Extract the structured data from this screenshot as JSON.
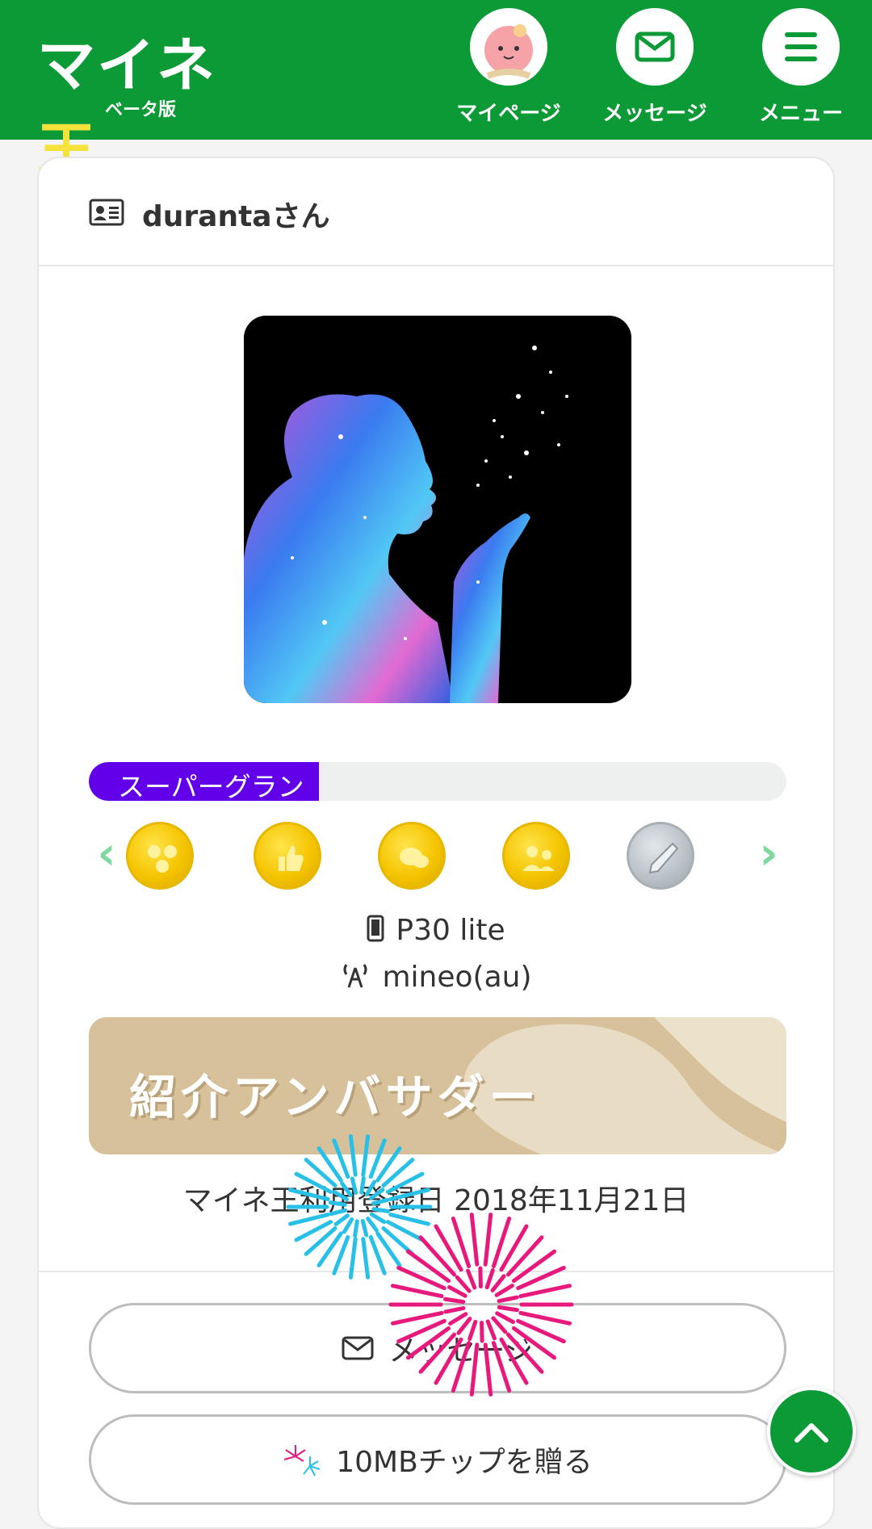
{
  "header": {
    "logo_text": "マイネ",
    "logo_king": "王",
    "logo_sub": "ベータ版",
    "nav": {
      "mypage": "マイページ",
      "message": "メッセージ",
      "menu": "メニュー"
    }
  },
  "profile": {
    "name": "durantaさん",
    "rank_label": "スーパーグラン",
    "rank_progress_fraction": 0.33,
    "badges": [
      "community-badge-icon",
      "like-badge-icon",
      "comment-badge-icon",
      "answer-badge-icon",
      "pen-badge-icon"
    ],
    "device_model": "P30 lite",
    "carrier": "mineo(au)",
    "ambassador_text": "紹介アンバサダー",
    "registration": "マイネ王利用登録日 2018年11月21日"
  },
  "actions": {
    "message_label": "メッセージ",
    "chip_label": "10MBチップを贈る"
  },
  "colors": {
    "header_green": "#0b9a35",
    "rank_purple": "#6200ea",
    "ambassador_tan": "#d6c19b",
    "firework_blue": "#29c0e8",
    "firework_pink": "#e8197d"
  }
}
